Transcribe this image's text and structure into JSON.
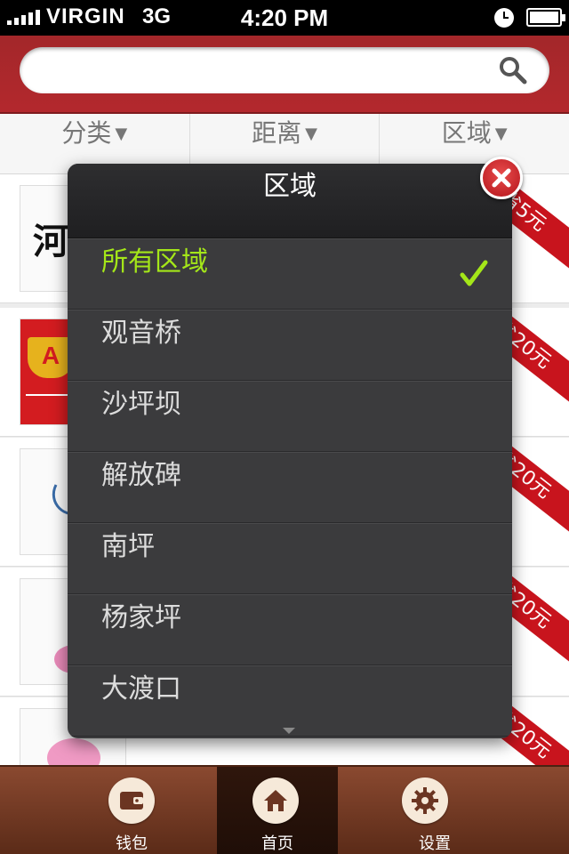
{
  "status_bar": {
    "carrier": "VIRGIN",
    "network": "3G",
    "time": "4:20 PM"
  },
  "search": {
    "value": "",
    "placeholder": ""
  },
  "filters": [
    {
      "label": "分类",
      "arrow": "▼"
    },
    {
      "label": "距离",
      "arrow": "▼"
    },
    {
      "label": "区域",
      "arrow": "▼"
    }
  ],
  "list": {
    "rows": [
      {
        "thumb_text": "河",
        "savings": "省5元"
      },
      {
        "thumb_text": "A",
        "savings": "省20元"
      },
      {
        "thumb_text": "",
        "savings": "省20元"
      },
      {
        "thumb_text": "",
        "savings": "省20元"
      },
      {
        "thumb_text": "",
        "savings": "省20元"
      }
    ]
  },
  "popup": {
    "title": "区域",
    "options": [
      {
        "label": "所有区域",
        "selected": true
      },
      {
        "label": "观音桥",
        "selected": false
      },
      {
        "label": "沙坪坝",
        "selected": false
      },
      {
        "label": "解放碑",
        "selected": false
      },
      {
        "label": "南坪",
        "selected": false
      },
      {
        "label": "杨家坪",
        "selected": false
      },
      {
        "label": "大渡口",
        "selected": false
      }
    ],
    "selected_color": "#a4e619"
  },
  "tabbar": {
    "tabs": [
      {
        "label": "钱包",
        "icon": "wallet-icon",
        "active": false
      },
      {
        "label": "首页",
        "icon": "home-icon",
        "active": true
      },
      {
        "label": "设置",
        "icon": "gear-icon",
        "active": false
      }
    ]
  },
  "colors": {
    "header_red": "#a3272a",
    "ribbon_red": "#c8141d",
    "tabbar_brown": "#6e3822"
  }
}
